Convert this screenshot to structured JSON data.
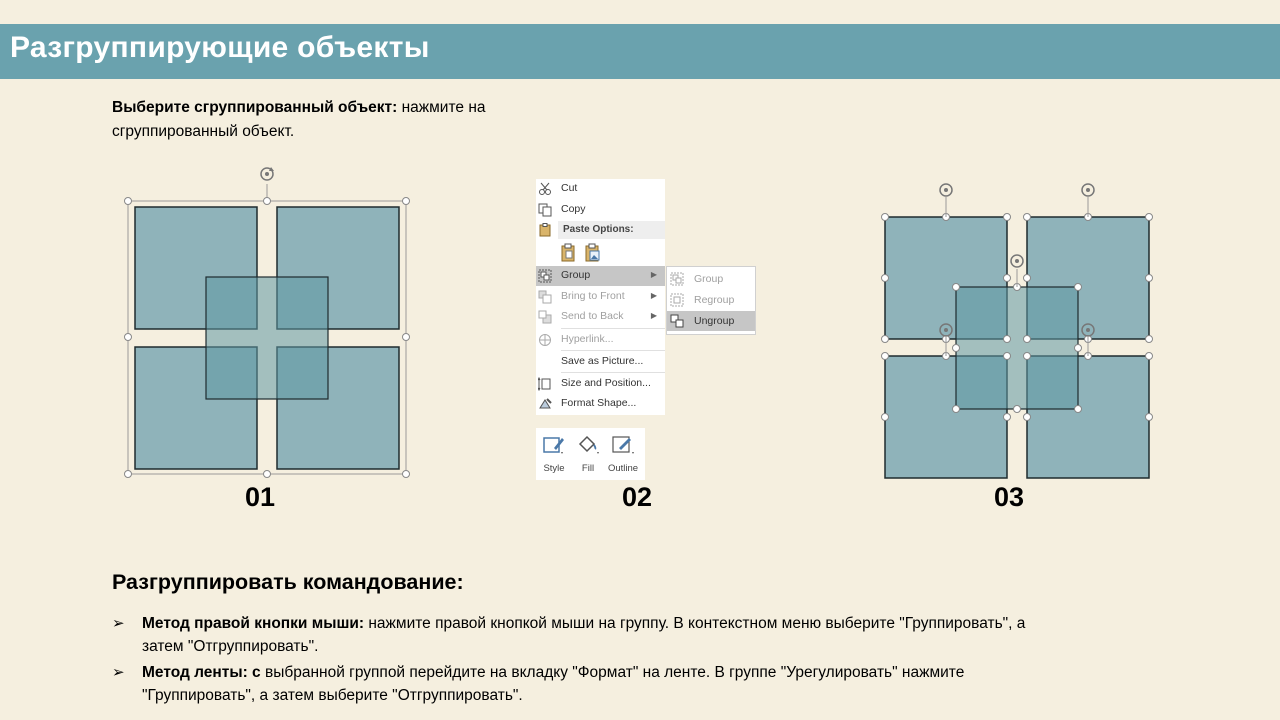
{
  "slide": {
    "title": "Разгруппирующие объекты",
    "intro_bold": "Выберите сгруппированный объект:",
    "intro_text": " нажмите на сгруппированный объект.",
    "figure_labels": [
      "01",
      "02",
      "03"
    ],
    "section_title": "Разгруппировать командование:",
    "bullets": [
      {
        "bold": "Метод правой кнопки мыши:",
        "text": " нажмите правой кнопкой мыши на группу. В контекстном меню выберите \"Группировать\", а затем \"Отгруппировать\"."
      },
      {
        "bold": "Метод ленты: с",
        "text": " выбранной группой перейдите на вкладку \"Формат\" на ленте. В группе \"Урегулировать\" нажмите \"Группировать\", а затем выберите \"Отгруппировать\"."
      }
    ],
    "bullet_marker": "➢"
  },
  "context_menu": {
    "items": [
      {
        "label": "Cut",
        "icon": "scissors-icon",
        "disabled": false
      },
      {
        "label": "Copy",
        "icon": "copy-icon",
        "disabled": false
      },
      {
        "label": "Paste Options:",
        "icon": "paste-icon",
        "disabled": false
      },
      {
        "label": "Group",
        "icon": "group-icon",
        "disabled": false,
        "active": true,
        "submenu": true
      },
      {
        "label": "Bring to Front",
        "icon": "bring-front-icon",
        "disabled": true,
        "submenu": true
      },
      {
        "label": "Send to Back",
        "icon": "send-back-icon",
        "disabled": true,
        "submenu": true
      },
      {
        "label": "Hyperlink...",
        "icon": "hyperlink-icon",
        "disabled": true
      },
      {
        "label": "Save as Picture...",
        "icon": "",
        "disabled": false
      },
      {
        "label": "Size and Position...",
        "icon": "size-position-icon",
        "disabled": false
      },
      {
        "label": "Format Shape...",
        "icon": "format-shape-icon",
        "disabled": false
      }
    ],
    "submenu": [
      {
        "label": "Group",
        "disabled": true
      },
      {
        "label": "Regroup",
        "disabled": true
      },
      {
        "label": "Ungroup",
        "disabled": false,
        "active": true
      }
    ],
    "mini_toolbar": [
      {
        "label": "Style",
        "icon": "style-icon"
      },
      {
        "label": "Fill",
        "icon": "fill-bucket-icon"
      },
      {
        "label": "Outline",
        "icon": "outline-pen-icon"
      }
    ]
  },
  "colors": {
    "title_bar": "#6aa2ae",
    "background": "#f5efdf",
    "shape_fill": "#8fb3ba",
    "shape_overlay": "#6ea0ab",
    "menu_highlight": "#c6c6c6"
  }
}
